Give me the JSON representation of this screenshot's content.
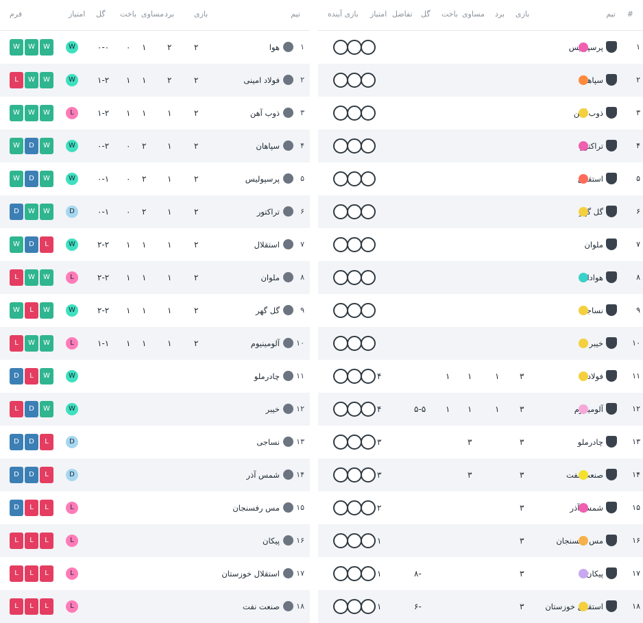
{
  "left_table": {
    "headers": [
      "تیم",
      "بازی",
      "برد",
      "مساوی",
      "باخت",
      "گل",
      "امتیاز",
      "فرم"
    ],
    "rows": [
      {
        "rank": "۱",
        "team": "هوا",
        "played": "۲",
        "won": "۲",
        "drawn": "۱",
        "lost": "۰",
        "goals": "۰-۰",
        "points": "۷",
        "last": "W",
        "form": [
          "W",
          "W",
          "W"
        ]
      },
      {
        "rank": "۲",
        "team": "فولاد امینی",
        "played": "۲",
        "won": "۲",
        "drawn": "۱",
        "lost": "۱",
        "goals": "۱-۲",
        "points": "۶",
        "last": "W",
        "form": [
          "L",
          "W",
          "W"
        ]
      },
      {
        "rank": "۳",
        "team": "ذوب آهن",
        "played": "۲",
        "won": "۱",
        "drawn": "۱",
        "lost": "۱",
        "goals": "۱-۲",
        "points": "۶",
        "last": "L",
        "form": [
          "W",
          "W",
          "W"
        ]
      },
      {
        "rank": "۴",
        "team": "سپاهان",
        "played": "۲",
        "won": "۱",
        "drawn": "۲",
        "lost": "۰",
        "goals": "۰-۲",
        "points": "۵",
        "last": "W",
        "form": [
          "W",
          "D",
          "W"
        ]
      },
      {
        "rank": "۵",
        "team": "پرسپولیس",
        "played": "۲",
        "won": "۱",
        "drawn": "۲",
        "lost": "۰",
        "goals": "۰-۱",
        "points": "۵",
        "last": "W",
        "form": [
          "W",
          "D",
          "W"
        ]
      },
      {
        "rank": "۶",
        "team": "تراکتور",
        "played": "۲",
        "won": "۱",
        "drawn": "۲",
        "lost": "۰",
        "goals": "۰-۱",
        "points": "۵",
        "last": "D",
        "form": [
          "D",
          "W",
          "W"
        ]
      },
      {
        "rank": "۷",
        "team": "استقلال",
        "played": "۲",
        "won": "۱",
        "drawn": "۱",
        "lost": "۱",
        "goals": "۲-۲",
        "points": "۴",
        "last": "W",
        "form": [
          "W",
          "D",
          "L"
        ]
      },
      {
        "rank": "۸",
        "team": "ملوان",
        "played": "۲",
        "won": "۱",
        "drawn": "۱",
        "lost": "۱",
        "goals": "۲-۲",
        "points": "۴",
        "last": "L",
        "form": [
          "L",
          "W",
          "W"
        ]
      },
      {
        "rank": "۹",
        "team": "گل گهر",
        "played": "۲",
        "won": "۱",
        "drawn": "۱",
        "lost": "۱",
        "goals": "۲-۲",
        "points": "۴",
        "last": "W",
        "form": [
          "W",
          "L",
          "W"
        ]
      },
      {
        "rank": "۱۰",
        "team": "آلومینیوم",
        "played": "۲",
        "won": "۱",
        "drawn": "۱",
        "lost": "۱",
        "goals": "۱-۱",
        "points": "۴",
        "last": "L",
        "form": [
          "L",
          "W",
          "W"
        ]
      },
      {
        "rank": "۱۱",
        "team": "چادرملو",
        "played": "",
        "won": "",
        "drawn": "",
        "lost": "",
        "goals": "",
        "points": "",
        "last": "W",
        "form": [
          "D",
          "L",
          "W"
        ]
      },
      {
        "rank": "۱۲",
        "team": "خیبر",
        "played": "",
        "won": "",
        "drawn": "",
        "lost": "",
        "goals": "",
        "points": "",
        "last": "W",
        "form": [
          "L",
          "D",
          "W"
        ]
      },
      {
        "rank": "۱۳",
        "team": "نساجی",
        "played": "",
        "won": "",
        "drawn": "",
        "lost": "",
        "goals": "",
        "points": "",
        "last": "D",
        "form": [
          "D",
          "D",
          "L"
        ]
      },
      {
        "rank": "۱۴",
        "team": "شمس آذر",
        "played": "",
        "won": "",
        "drawn": "",
        "lost": "",
        "goals": "",
        "points": "",
        "last": "D",
        "form": [
          "D",
          "D",
          "L"
        ]
      },
      {
        "rank": "۱۵",
        "team": "مس رفسنجان",
        "played": "",
        "won": "",
        "drawn": "",
        "lost": "",
        "goals": "",
        "points": "",
        "last": "L",
        "form": [
          "D",
          "L",
          "L"
        ]
      },
      {
        "rank": "۱۶",
        "team": "پیکان",
        "played": "",
        "won": "",
        "drawn": "",
        "lost": "",
        "goals": "",
        "points": "",
        "last": "L",
        "form": [
          "L",
          "L",
          "L"
        ]
      },
      {
        "rank": "۱۷",
        "team": "استقلال خوزستان",
        "played": "",
        "won": "",
        "drawn": "",
        "lost": "",
        "goals": "",
        "points": "",
        "last": "L",
        "form": [
          "L",
          "L",
          "L"
        ]
      },
      {
        "rank": "۱۸",
        "team": "صنعت نفت",
        "played": "",
        "won": "",
        "drawn": "",
        "lost": "",
        "goals": "",
        "points": "",
        "last": "L",
        "form": [
          "L",
          "L",
          "L"
        ]
      }
    ]
  },
  "right_table": {
    "headers": {
      "rank": "#",
      "team": "تیم",
      "played": "بازی",
      "won": "برد",
      "drawn": "مساوی",
      "lost": "باخت",
      "goals": "گل",
      "diff": "تفاضل",
      "points": "امتیاز",
      "next": "بازی آینده"
    },
    "rows": [
      {
        "rank": "۱",
        "team": "پرسپولیس",
        "played": "",
        "won": "",
        "drawn": "",
        "lost": "",
        "goals": "",
        "diff": "",
        "points": "",
        "dot": "#f05fb0",
        "next": "upcoming-a"
      },
      {
        "rank": "۲",
        "team": "سپاهان",
        "played": "",
        "won": "",
        "drawn": "",
        "lost": "",
        "goals": "",
        "diff": "",
        "points": "",
        "dot": "#ff8a3d",
        "next": "upcoming-a"
      },
      {
        "rank": "۳",
        "team": "ذوب آهن",
        "played": "",
        "won": "",
        "drawn": "",
        "lost": "",
        "goals": "",
        "diff": "",
        "points": "",
        "dot": "#f4d03f",
        "next": "upcoming-a"
      },
      {
        "rank": "۴",
        "team": "تراکتور",
        "played": "",
        "won": "",
        "drawn": "",
        "lost": "",
        "goals": "",
        "diff": "",
        "points": "",
        "dot": "#f05fb0",
        "next": "upcoming-a"
      },
      {
        "rank": "۵",
        "team": "استقلال",
        "played": "",
        "won": "",
        "drawn": "",
        "lost": "",
        "goals": "",
        "diff": "",
        "points": "",
        "dot": "#ff6b5b",
        "next": "upcoming-a"
      },
      {
        "rank": "۶",
        "team": "گل گهر",
        "played": "",
        "won": "",
        "drawn": "",
        "lost": "",
        "goals": "",
        "diff": "",
        "points": "",
        "dot": "#f4d03f",
        "next": "upcoming-a"
      },
      {
        "rank": "۷",
        "team": "ملوان",
        "played": "",
        "won": "",
        "drawn": "",
        "lost": "",
        "goals": "",
        "diff": "",
        "points": "",
        "dot": "",
        "next": "upcoming-a"
      },
      {
        "rank": "۸",
        "team": "هوادار",
        "played": "",
        "won": "",
        "drawn": "",
        "lost": "",
        "goals": "",
        "diff": "",
        "points": "",
        "dot": "#3ad1c9",
        "next": "upcoming-a"
      },
      {
        "rank": "۹",
        "team": "نساجی",
        "played": "",
        "won": "",
        "drawn": "",
        "lost": "",
        "goals": "",
        "diff": "",
        "points": "",
        "dot": "#f4d03f",
        "next": "upcoming-a"
      },
      {
        "rank": "۱۰",
        "team": "خیبر",
        "played": "",
        "won": "",
        "drawn": "",
        "lost": "",
        "goals": "",
        "diff": "",
        "points": "",
        "dot": "#f4d03f",
        "next": "upcoming-a"
      },
      {
        "rank": "۱۱",
        "team": "فولاد",
        "played": "۳",
        "won": "۱",
        "drawn": "۱",
        "lost": "۱",
        "goals": "",
        "diff": "",
        "points": "۴",
        "dot": "#f4d03f",
        "next": "upcoming-b"
      },
      {
        "rank": "۱۲",
        "team": "آلومینیوم",
        "played": "۳",
        "won": "۱",
        "drawn": "۱",
        "lost": "۱",
        "goals": "۵-۵",
        "diff": "",
        "points": "۴",
        "dot": "#f7a8d8",
        "next": "upcoming-b"
      },
      {
        "rank": "۱۳",
        "team": "چادرملو",
        "played": "۳",
        "won": "",
        "drawn": "۳",
        "lost": "",
        "goals": "",
        "diff": "",
        "points": "۳",
        "dot": "",
        "next": "upcoming-b"
      },
      {
        "rank": "۱۴",
        "team": "صنعت نفت",
        "played": "۳",
        "won": "",
        "drawn": "۳",
        "lost": "",
        "goals": "",
        "diff": "",
        "points": "۳",
        "dot": "#f4e02f",
        "next": "upcoming-b"
      },
      {
        "rank": "۱۵",
        "team": "شمس آذر",
        "played": "۳",
        "won": "",
        "drawn": "",
        "lost": "",
        "goals": "",
        "diff": "",
        "points": "۲",
        "dot": "#f05fb0",
        "next": "upcoming-b"
      },
      {
        "rank": "۱۶",
        "team": "مس رفسنجان",
        "played": "۳",
        "won": "",
        "drawn": "",
        "lost": "",
        "goals": "",
        "diff": "",
        "points": "۱",
        "dot": "#f7b14a",
        "next": "upcoming-b"
      },
      {
        "rank": "۱۷",
        "team": "پیکان",
        "played": "۳",
        "won": "",
        "drawn": "",
        "lost": "",
        "goals": "۸-",
        "diff": "",
        "points": "۱",
        "dot": "#c8a8f0",
        "next": "upcoming-b"
      },
      {
        "rank": "۱۸",
        "team": "استقلال خوزستان",
        "played": "۳",
        "won": "",
        "drawn": "",
        "lost": "",
        "goals": "۶-",
        "diff": "",
        "points": "۱",
        "dot": "#f4d03f",
        "next": "upcoming-b"
      }
    ]
  }
}
